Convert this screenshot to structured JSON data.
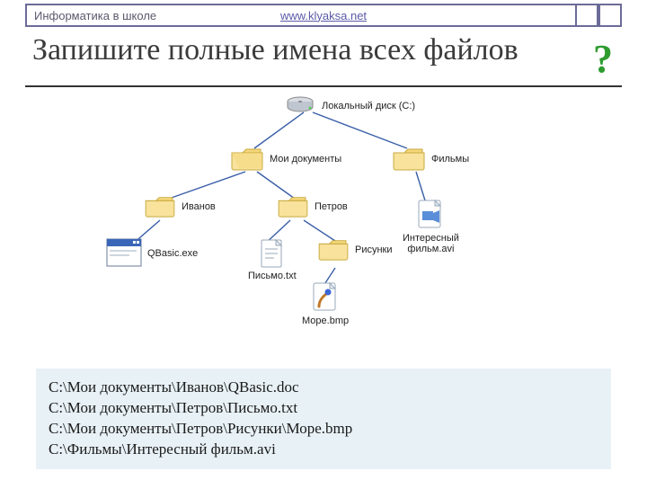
{
  "header": {
    "left": "Информатика в школе",
    "link": "www.klyaksa.net"
  },
  "title": "Запишите полные имена всех файлов",
  "qmark": "?",
  "tree": {
    "root": "Локальный диск (C:)",
    "docs": "Мои документы",
    "movies": "Фильмы",
    "ivanov": "Иванов",
    "petrov": "Петров",
    "qbasic": "QBasic.exe",
    "letter": "Письмо.txt",
    "pictures": "Рисунки",
    "sea": "Море.bmp",
    "movie_file": "Интересный\nфильм.avi"
  },
  "answers": {
    "l1": "C:\\Мои документы\\Иванов\\QBasic.doc",
    "l2": "C:\\Мои документы\\Петров\\Письмо.txt",
    "l3": "C:\\Мои документы\\Петров\\Рисунки\\Море.bmp",
    "l4": "C:\\Фильмы\\Интересный фильм.avi"
  }
}
